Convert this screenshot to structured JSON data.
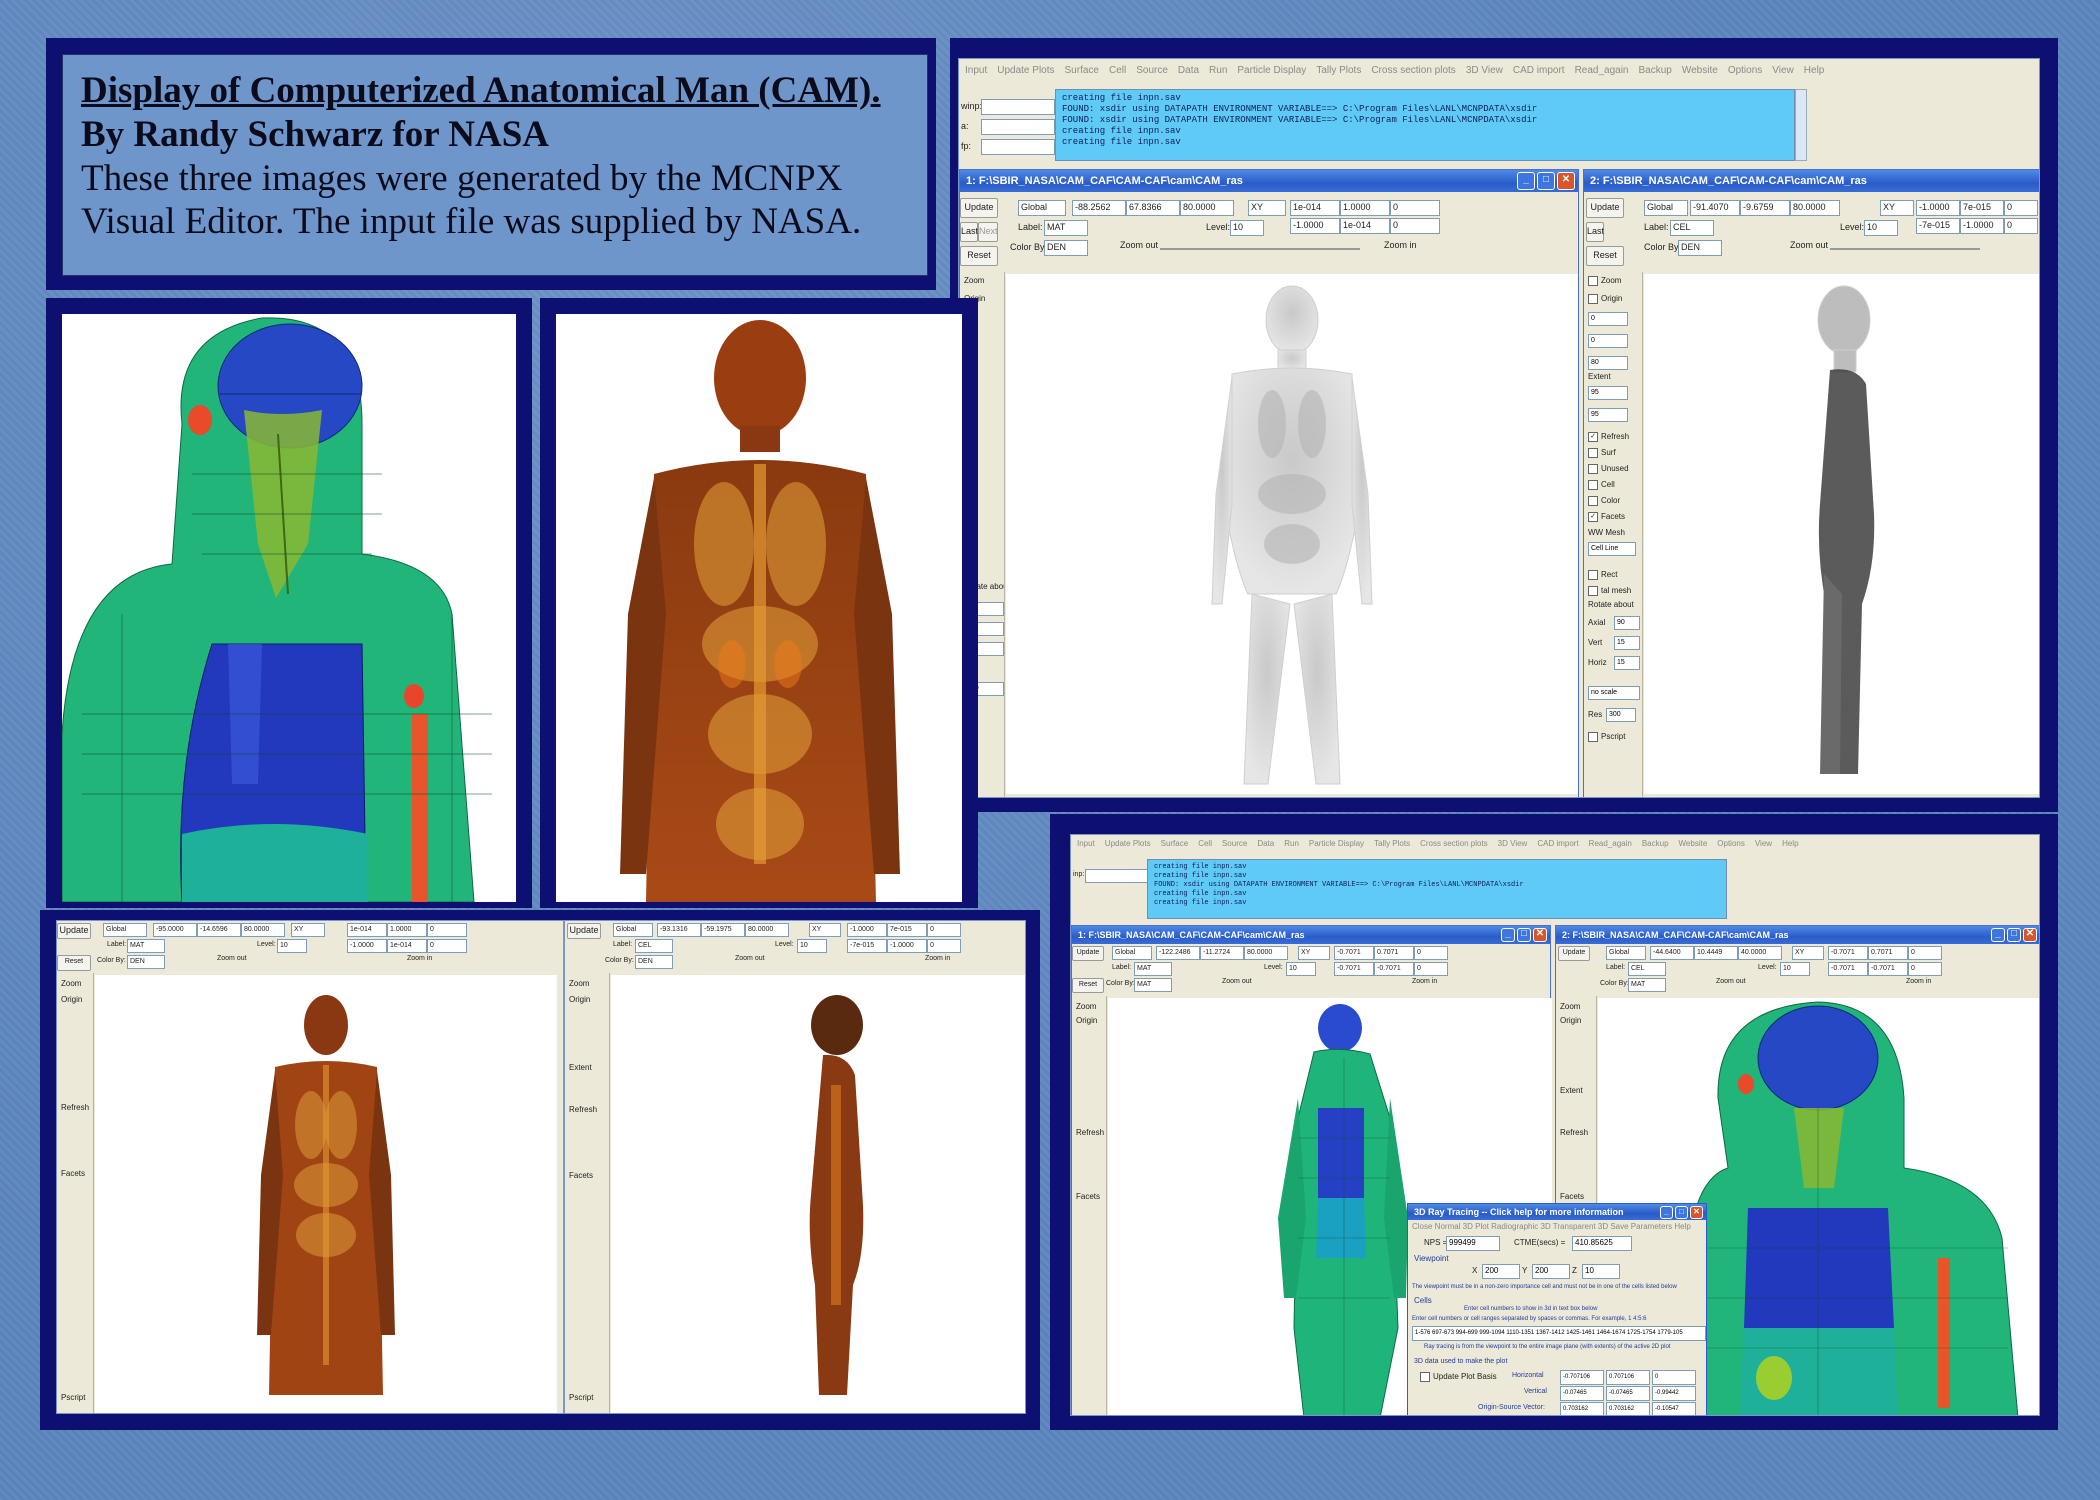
{
  "title_card": {
    "line1": "Display of Computerized Anatomical Man (CAM).",
    "line2": "By Randy Schwarz for NASA",
    "body1": "These three images were generated by the MCNPX",
    "body2": "Visual Editor.  The input file was supplied by NASA."
  },
  "menubar": [
    "Input",
    "Update Plots",
    "Surface",
    "Cell",
    "Source",
    "Data",
    "Run",
    "Particle Display",
    "Tally Plots",
    "Cross section plots",
    "3D View",
    "CAD import",
    "Read_again",
    "Backup",
    "Website",
    "Options",
    "View",
    "Help"
  ],
  "console_top": [
    "creating file inpn.sav",
    "FOUND: xsdir  using DATAPATH ENVIRONMENT VARIABLE==>  C:\\Program Files\\LANL\\MCNPDATA\\xsdir",
    "FOUND: xsdir  using DATAPATH ENVIRONMENT VARIABLE==>  C:\\Program Files\\LANL\\MCNPDATA\\xsdir",
    "creating file inpn.sav",
    "creating file inpn.sav"
  ],
  "console_bottom": [
    "creating file inpn.sav",
    "creating file inpn.sav",
    "FOUND: xsdir  using DATAPATH ENVIRONMENT VARIABLE==>  C:\\Program Files\\LANL\\MCNPDATA\\xsdir",
    "creating file inpn.sav",
    "creating file inpn.sav"
  ],
  "left_labels": {
    "winp": "winp:",
    "a": "a:",
    "fp": "fp:",
    "inp": "inp:"
  },
  "win1": {
    "title": "1:  F:\\SBIR_NASA\\CAM_CAF\\CAM-CAF\\cam\\CAM_ras",
    "basis": "Global",
    "o1": "-88.2562",
    "o2": "67.8366",
    "o3": "80.0000",
    "plane": "XY",
    "e1": "1e-014",
    "e2": "1.0000",
    "e3": "0",
    "f1": "-1.0000",
    "f2": "1e-014",
    "f3": "0",
    "label": "MAT",
    "level": "10",
    "colorby": "DEN"
  },
  "win2": {
    "title": "2:  F:\\SBIR_NASA\\CAM_CAF\\CAM-CAF\\cam\\CAM_ras",
    "basis": "Global",
    "o1": "-91.4070",
    "o2": "-9.6759",
    "o3": "80.0000",
    "plane": "XY",
    "e1": "-1.0000",
    "e2": "7e-015",
    "e3": "0",
    "f1": "-7e-015",
    "f2": "-1.0000",
    "f3": "0",
    "label": "CEL",
    "level": "10",
    "colorby": "DEN"
  },
  "win3": {
    "basis": "Global",
    "o1": "-95.0000",
    "o2": "-14.6596",
    "o3": "80.0000",
    "plane": "XY",
    "e1": "1e-014",
    "e2": "1.0000",
    "e3": "0",
    "f1": "-1.0000",
    "f2": "1e-014",
    "f3": "0",
    "label": "MAT",
    "level": "10",
    "colorby": "DEN"
  },
  "win4": {
    "basis": "Global",
    "o1": "-93.1316",
    "o2": "-59.1975",
    "o3": "80.0000",
    "plane": "XY",
    "e1": "-1.0000",
    "e2": "7e-015",
    "e3": "0",
    "f1": "-7e-015",
    "f2": "-1.0000",
    "f3": "0",
    "label": "CEL",
    "level": "10",
    "colorby": "DEN"
  },
  "win5": {
    "title": "1:  F:\\SBIR_NASA\\CAM_CAF\\CAM-CAF\\cam\\CAM_ras",
    "basis": "Global",
    "o1": "-122.2486",
    "o2": "-11.2724",
    "o3": "80.0000",
    "plane": "XY",
    "e1": "-0.7071",
    "e2": "0.7071",
    "e3": "0",
    "f1": "-0.7071",
    "f2": "-0.7071",
    "f3": "0",
    "label": "MAT",
    "level": "10",
    "colorby": "MAT"
  },
  "win6": {
    "title": "2:  F:\\SBIR_NASA\\CAM_CAF\\CAM-CAF\\cam\\CAM_ras",
    "basis": "Global",
    "o1": "-44.6400",
    "o2": "10.4449",
    "o3": "40.0000",
    "plane": "XY",
    "e1": "-0.7071",
    "e2": "0.7071",
    "e3": "0",
    "f1": "-0.7071",
    "f2": "-0.7071",
    "f3": "0",
    "label": "CEL",
    "level": "10",
    "colorby": "MAT"
  },
  "buttons": {
    "update": "Update",
    "last": "Last",
    "next": "Next",
    "reset": "Reset",
    "zoom_out": "Zoom out",
    "zoom_in": "Zoom in",
    "label": "Label:",
    "level": "Level:",
    "colorby": "Color By:"
  },
  "sidebar": {
    "zoom": "Zoom",
    "origin": "Origin",
    "extent": "Extent",
    "refresh": "Refresh",
    "surf": "Surf",
    "unused": "Unused",
    "cell": "Cell",
    "color": "Color",
    "facets": "Facets",
    "wwmesh": "WW Mesh",
    "cellline": "Cell Line",
    "rect": "Rect",
    "talmesh": "tal mesh",
    "rotate": "Rotate about",
    "axial": "Axial",
    "vert": "Vert",
    "horiz": "Horiz",
    "noscale": "no scale",
    "res": "Res",
    "pscript": "Pscript",
    "v0": "0",
    "v80": "80",
    "v95": "95",
    "v16": "16",
    "v18": "18",
    "v15": "15",
    "v90": "90",
    "v300": "300"
  },
  "dialog": {
    "title": "3D Ray Tracing -- Click help for more information",
    "menu": "Close   Normal 3D Plot   Radiographic 3D   Transparent 3D   Save Parameters   Help",
    "nps_label": "NPS =",
    "nps": "999499",
    "ctme_label": "CTME(secs) =",
    "ctme": "410.85625",
    "viewpoint": "Viewpoint",
    "x_label": "X",
    "x": "200",
    "y_label": "Y",
    "y": "200",
    "z_label": "Z",
    "z": "10",
    "note1": "The viewpoint must be in a non-zero importance cell and must not be in one of the cells listed below",
    "cells": "Cells",
    "note2": "Enter cell numbers to show in 3d in text box below",
    "note3": "Enter cell numbers or cell ranges separated by spaces or commas.  For example, 1 4:5:6",
    "cell_list": "1-576 697-673 994-699 999-1094 1110-1351 1367-1412 1425-1461 1464-1674 1725-1754 1779-105",
    "note4": "Ray tracing is from the viewpoint to the entire image plane (with extents) of the active 2D plot",
    "data_label": "3D data used to make the plot",
    "update_basis": "Update Plot Basis",
    "horizontal": "Horizontal",
    "h1": "-0.707106",
    "h2": "0.707106",
    "h3": "0",
    "vertical": "Vertical",
    "v1": "-0.07465",
    "v2": "-0.07465",
    "v3": "-0.99442",
    "origin_source": "Origin-Source Vector:",
    "s1": "0.703162",
    "s2": "0.703162",
    "s3": "-0.10547"
  },
  "colors": {
    "background": "#5c86bf",
    "frame": "#0d1070",
    "console": "#5ecaf5",
    "titlebar": "#2a5cc8",
    "body_green": "#1fbf7a",
    "brain_blue": "#1e3fbf",
    "body_orange": "#b9531a"
  }
}
